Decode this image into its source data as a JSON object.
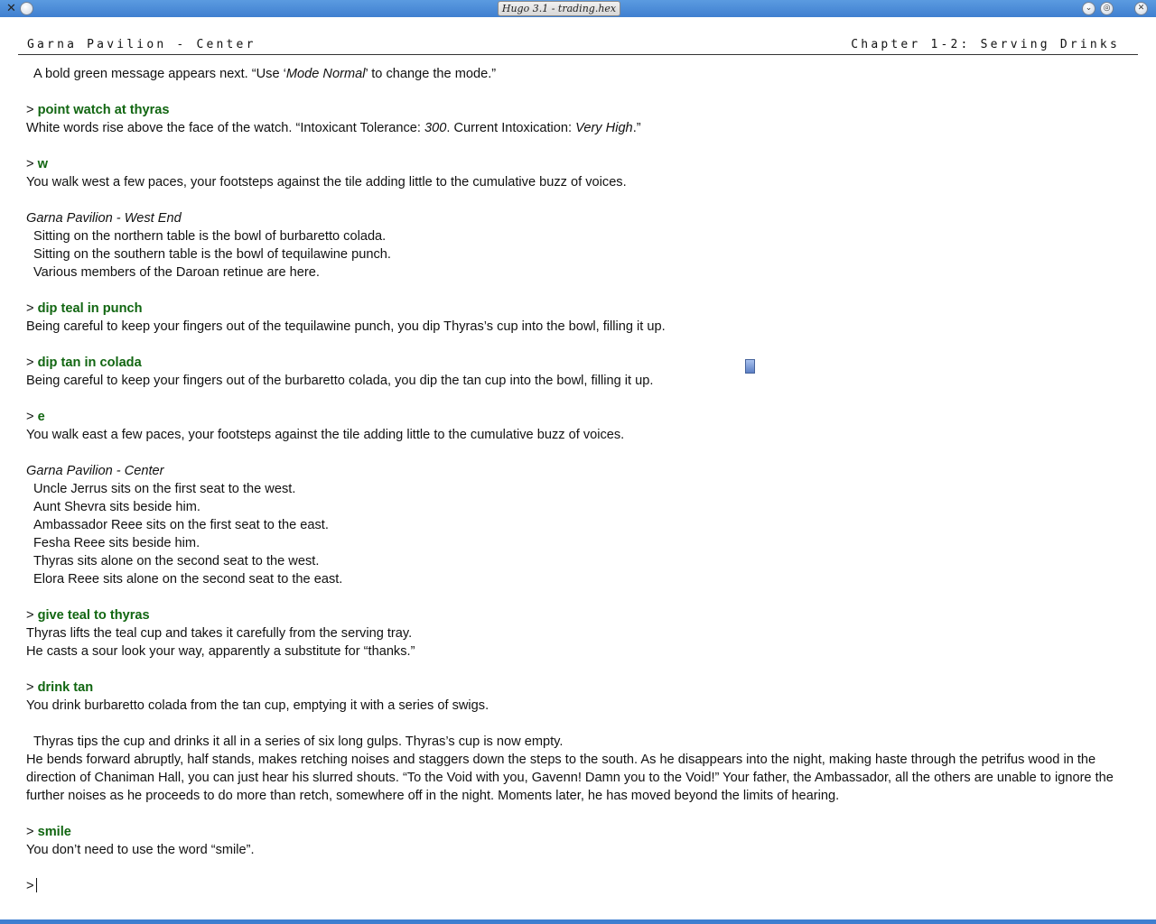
{
  "window": {
    "title": "Hugo 3.1 - trading.hex",
    "menu_icon": "x-menu-icon",
    "sticky_icon": "circle-icon",
    "minimize_icon": "chevron-down-icon",
    "maximize_icon": "gear-circle-icon",
    "close_icon": "close-icon",
    "accent_color": "#3f7fd0"
  },
  "status": {
    "location": "Garna Pavilion - Center",
    "chapter": "Chapter 1-2: Serving Drinks"
  },
  "transcript": [
    {
      "type": "text",
      "indent": true,
      "html": "A bold green message appears next. “Use ‘<i>Mode Normal</i>’ to change the mode.”"
    },
    {
      "type": "blank"
    },
    {
      "type": "cmd",
      "text": "point watch at thyras"
    },
    {
      "type": "text",
      "html": "White words rise above the face of the watch. “Intoxicant Tolerance: <i>300</i>. Current Intoxication: <i>Very High</i>.”"
    },
    {
      "type": "blank"
    },
    {
      "type": "cmd",
      "text": "w"
    },
    {
      "type": "text",
      "text": "You walk west a few paces, your footsteps against the tile adding little to the cumulative buzz of voices."
    },
    {
      "type": "blank"
    },
    {
      "type": "room",
      "text": "Garna Pavilion - West End"
    },
    {
      "type": "text",
      "indent": true,
      "text": "Sitting on the northern table is the bowl of burbaretto colada."
    },
    {
      "type": "text",
      "indent": true,
      "text": "Sitting on the southern table is the bowl of tequilawine punch."
    },
    {
      "type": "text",
      "indent": true,
      "text": "Various members of the Daroan retinue are here."
    },
    {
      "type": "blank"
    },
    {
      "type": "cmd",
      "text": "dip teal in punch"
    },
    {
      "type": "text",
      "text": "Being careful to keep your fingers out of the tequilawine punch, you dip Thyras’s cup into the bowl, filling it up."
    },
    {
      "type": "blank"
    },
    {
      "type": "cmd",
      "text": "dip tan in colada"
    },
    {
      "type": "text",
      "text": "Being careful to keep your fingers out of the burbaretto colada, you dip the tan cup into the bowl, filling it up."
    },
    {
      "type": "blank"
    },
    {
      "type": "cmd",
      "text": "e"
    },
    {
      "type": "text",
      "text": "You walk east a few paces, your footsteps against the tile adding little to the cumulative buzz of voices."
    },
    {
      "type": "blank"
    },
    {
      "type": "room",
      "text": "Garna Pavilion - Center"
    },
    {
      "type": "text",
      "indent": true,
      "text": "Uncle Jerrus sits on the first seat to the west."
    },
    {
      "type": "text",
      "indent": true,
      "text": "Aunt Shevra sits beside him."
    },
    {
      "type": "text",
      "indent": true,
      "text": "Ambassador Reee sits on the first seat to the east."
    },
    {
      "type": "text",
      "indent": true,
      "text": "Fesha Reee sits beside him."
    },
    {
      "type": "text",
      "indent": true,
      "text": "Thyras sits alone on the second seat to the west."
    },
    {
      "type": "text",
      "indent": true,
      "text": "Elora Reee sits alone on the second seat to the east."
    },
    {
      "type": "blank"
    },
    {
      "type": "cmd",
      "text": "give teal to thyras"
    },
    {
      "type": "text",
      "text": "Thyras lifts the teal cup and takes it carefully from the serving tray."
    },
    {
      "type": "text",
      "text": "He casts a sour look your way, apparently a substitute for “thanks.”"
    },
    {
      "type": "blank"
    },
    {
      "type": "cmd",
      "text": "drink tan"
    },
    {
      "type": "text",
      "text": "You drink burbaretto colada from the tan cup, emptying it with a series of swigs."
    },
    {
      "type": "blank"
    },
    {
      "type": "text",
      "indent": true,
      "text": "Thyras tips the cup and drinks it all in a series of six long gulps. Thyras’s cup is now empty."
    },
    {
      "type": "text",
      "text": "He bends forward abruptly, half stands, makes retching noises and staggers down the steps to the south. As he disappears into the night, making haste through the petrifus wood in the direction of Chaniman Hall, you can just hear his slurred shouts. “To the Void with you, Gavenn! Damn you to the Void!” Your father, the Ambassador, all the others are unable to ignore the further noises as he proceeds to do more than retch, somewhere off in the night. Moments later, he has moved beyond the limits of hearing."
    },
    {
      "type": "blank"
    },
    {
      "type": "cmd",
      "text": "smile"
    },
    {
      "type": "text",
      "text": "You don’t need to use the word “smile”."
    },
    {
      "type": "blank"
    },
    {
      "type": "prompt",
      "text": ""
    }
  ],
  "prompt_symbol": ">",
  "command_color": "#116611"
}
